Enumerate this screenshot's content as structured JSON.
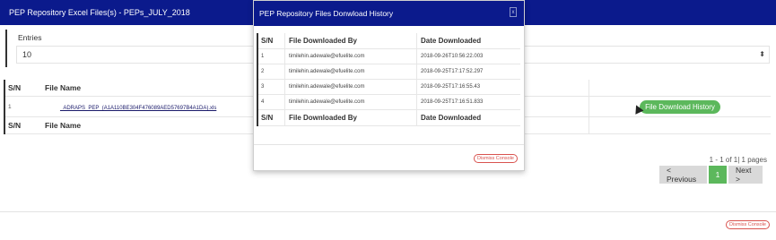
{
  "main": {
    "title": "PEP Repository Excel Files(s) - PEPs_JULY_2018",
    "close_label": "x",
    "entries_label": "Entries",
    "entries_value": "10",
    "table": {
      "headers": [
        "S/N",
        "File Name"
      ],
      "rows": [
        {
          "sn": "1",
          "file": "_ADRAPS_PEP_(A1A110BE304F476089AED57697B4A1DA).xls",
          "action": "File Download History"
        }
      ]
    },
    "pagination": {
      "info": "1 - 1 of 1| 1 pages",
      "prev": "< Previous",
      "page": "1",
      "next": "Next >"
    },
    "dismiss": "Dismiss Console"
  },
  "modal": {
    "title": "PEP Repository Files Donwload History",
    "close_label": "x",
    "headers": [
      "S/N",
      "File Downloaded By",
      "Date Downloaded"
    ],
    "rows": [
      {
        "sn": "1",
        "by": "timilehin.adewale@efuelite.com",
        "date": "2018-09-26T10:56:22.003"
      },
      {
        "sn": "2",
        "by": "timilehin.adewale@efuelite.com",
        "date": "2018-09-25T17:17:52.297"
      },
      {
        "sn": "3",
        "by": "timilehin.adewale@efuelite.com",
        "date": "2018-09-25T17:16:55.43"
      },
      {
        "sn": "4",
        "by": "timilehin.adewale@efuelite.com",
        "date": "2018-09-25T17:16:51.833"
      }
    ],
    "dismiss": "Dismiss Console"
  },
  "colors": {
    "header": "#0b1a8c",
    "success": "#5cb85c",
    "danger": "#d9534f"
  }
}
